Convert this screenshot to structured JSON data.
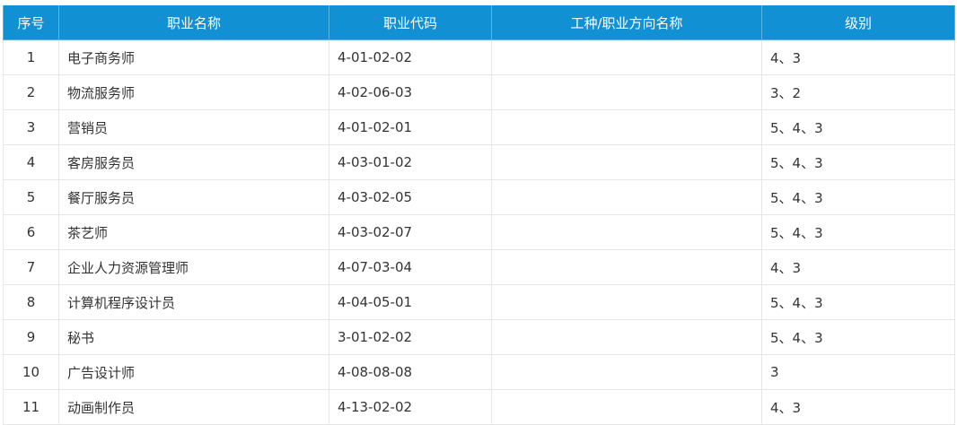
{
  "table": {
    "headers": [
      "序号",
      "职业名称",
      "职业代码",
      "工种/职业方向名称",
      "级别"
    ],
    "rows": [
      [
        "1",
        "电子商务师",
        "4-01-02-02",
        "",
        "4、3"
      ],
      [
        "2",
        "物流服务师",
        "4-02-06-03",
        "",
        "3、2"
      ],
      [
        "3",
        "营销员",
        "4-01-02-01",
        "",
        "5、4、3"
      ],
      [
        "4",
        "客房服务员",
        "4-03-01-02",
        "",
        "5、4、3"
      ],
      [
        "5",
        "餐厅服务员",
        "4-03-02-05",
        "",
        "5、4、3"
      ],
      [
        "6",
        "茶艺师",
        "4-03-02-07",
        "",
        "5、4、3"
      ],
      [
        "7",
        "企业人力资源管理师",
        "4-07-03-04",
        "",
        "4、3"
      ],
      [
        "8",
        "计算机程序设计员",
        "4-04-05-01",
        "",
        "5、4、3"
      ],
      [
        "9",
        "秘书",
        "3-01-02-02",
        "",
        "5、4、3"
      ],
      [
        "10",
        "广告设计师",
        "4-08-08-08",
        "",
        "3"
      ],
      [
        "11",
        "动画制作员",
        "4-13-02-02",
        "",
        "4、3"
      ]
    ]
  },
  "colors": {
    "header_bg": "#1190d4",
    "header_text": "#ffffff",
    "cell_border": "#e6e6e6",
    "body_text": "#333333"
  }
}
